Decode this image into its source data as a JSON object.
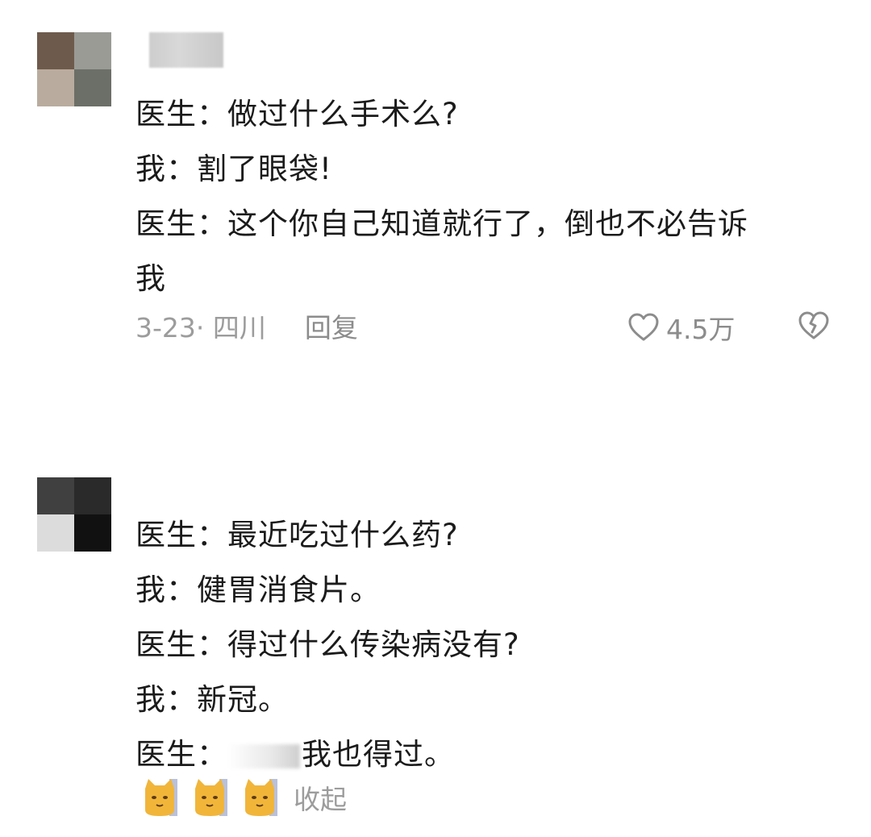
{
  "comments": [
    {
      "lines": [
        "医生：做过什么手术么?",
        "我：割了眼袋!",
        "医生：这个你自己知道就行了，倒也不必告诉",
        "我"
      ],
      "date_location": "3-23· 四川",
      "reply_label": "回复",
      "likes": "4.5万",
      "avatar_colors": [
        "#6e5a4c",
        "#9a9b95",
        "#b9ac9f",
        "#6c6f67"
      ]
    },
    {
      "lines": [
        "医生：最近吃过什么药?",
        "我：健胃消食片。",
        "医生：得过什么传染病没有?",
        "我：新冠。"
      ],
      "last_line_prefix": "医生：",
      "last_line_suffix": "我也得过。",
      "collapse_label": "收起",
      "avatar_colors": [
        "#404040",
        "#2a2a2a",
        "#dcdcdc",
        "#111111"
      ]
    }
  ],
  "icons": {
    "like": "heart-outline-icon",
    "dislike": "broken-heart-icon",
    "emoji": "cat-face-emoji"
  }
}
